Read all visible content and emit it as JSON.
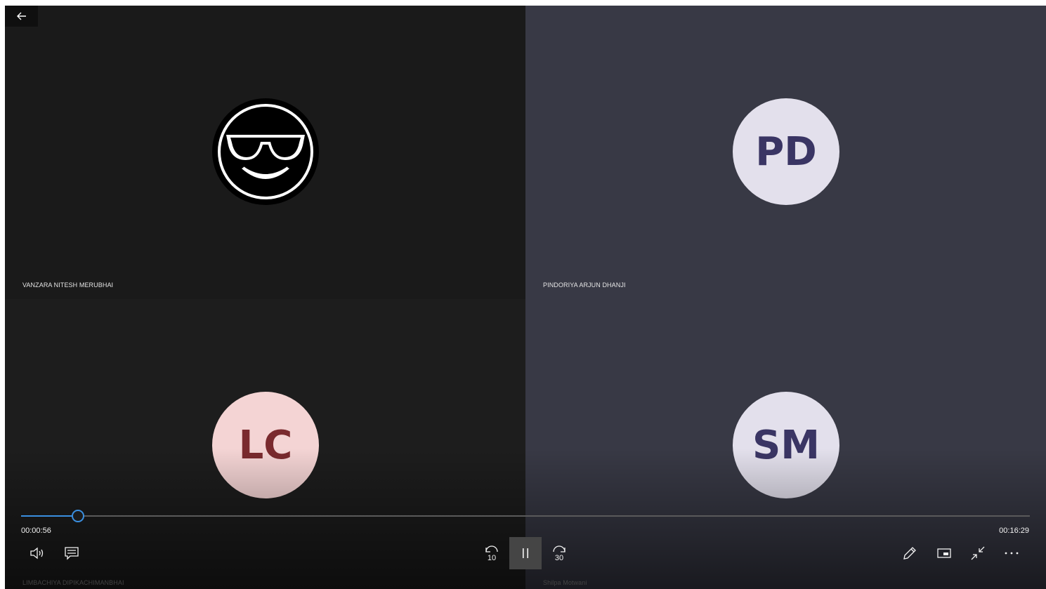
{
  "participants": [
    {
      "name": "VANZARA NITESH MERUBHAI",
      "avatar_type": "emoji",
      "avatar_icon": "sunglasses-smiley"
    },
    {
      "name": "PINDORIYA ARJUN DHANJI",
      "initials": "PD",
      "avatar_bg": "#e3e0ec",
      "initials_color": "#3a3564"
    },
    {
      "name": "LIMBACHIYA DIPIKACHIMANBHAI",
      "initials": "LC",
      "avatar_bg": "#f4d4d4",
      "initials_color": "#7a2a2e"
    },
    {
      "name": "Shilpa Motwani",
      "initials": "SM",
      "avatar_bg": "#e3e0ec",
      "initials_color": "#3a3564"
    }
  ],
  "playback": {
    "current_time": "00:00:56",
    "total_time": "00:16:29",
    "progress_fraction": 0.0566,
    "accent_color": "#3a8fe0"
  },
  "controls": {
    "left": [
      "volume-icon",
      "captions-icon"
    ],
    "center": [
      "skip-back-10-icon",
      "pause-icon",
      "skip-forward-30-icon"
    ],
    "right": [
      "pen-icon",
      "mini-view-icon",
      "exit-fullscreen-icon",
      "more-icon"
    ],
    "skip_back_label": "10",
    "skip_forward_label": "30"
  }
}
